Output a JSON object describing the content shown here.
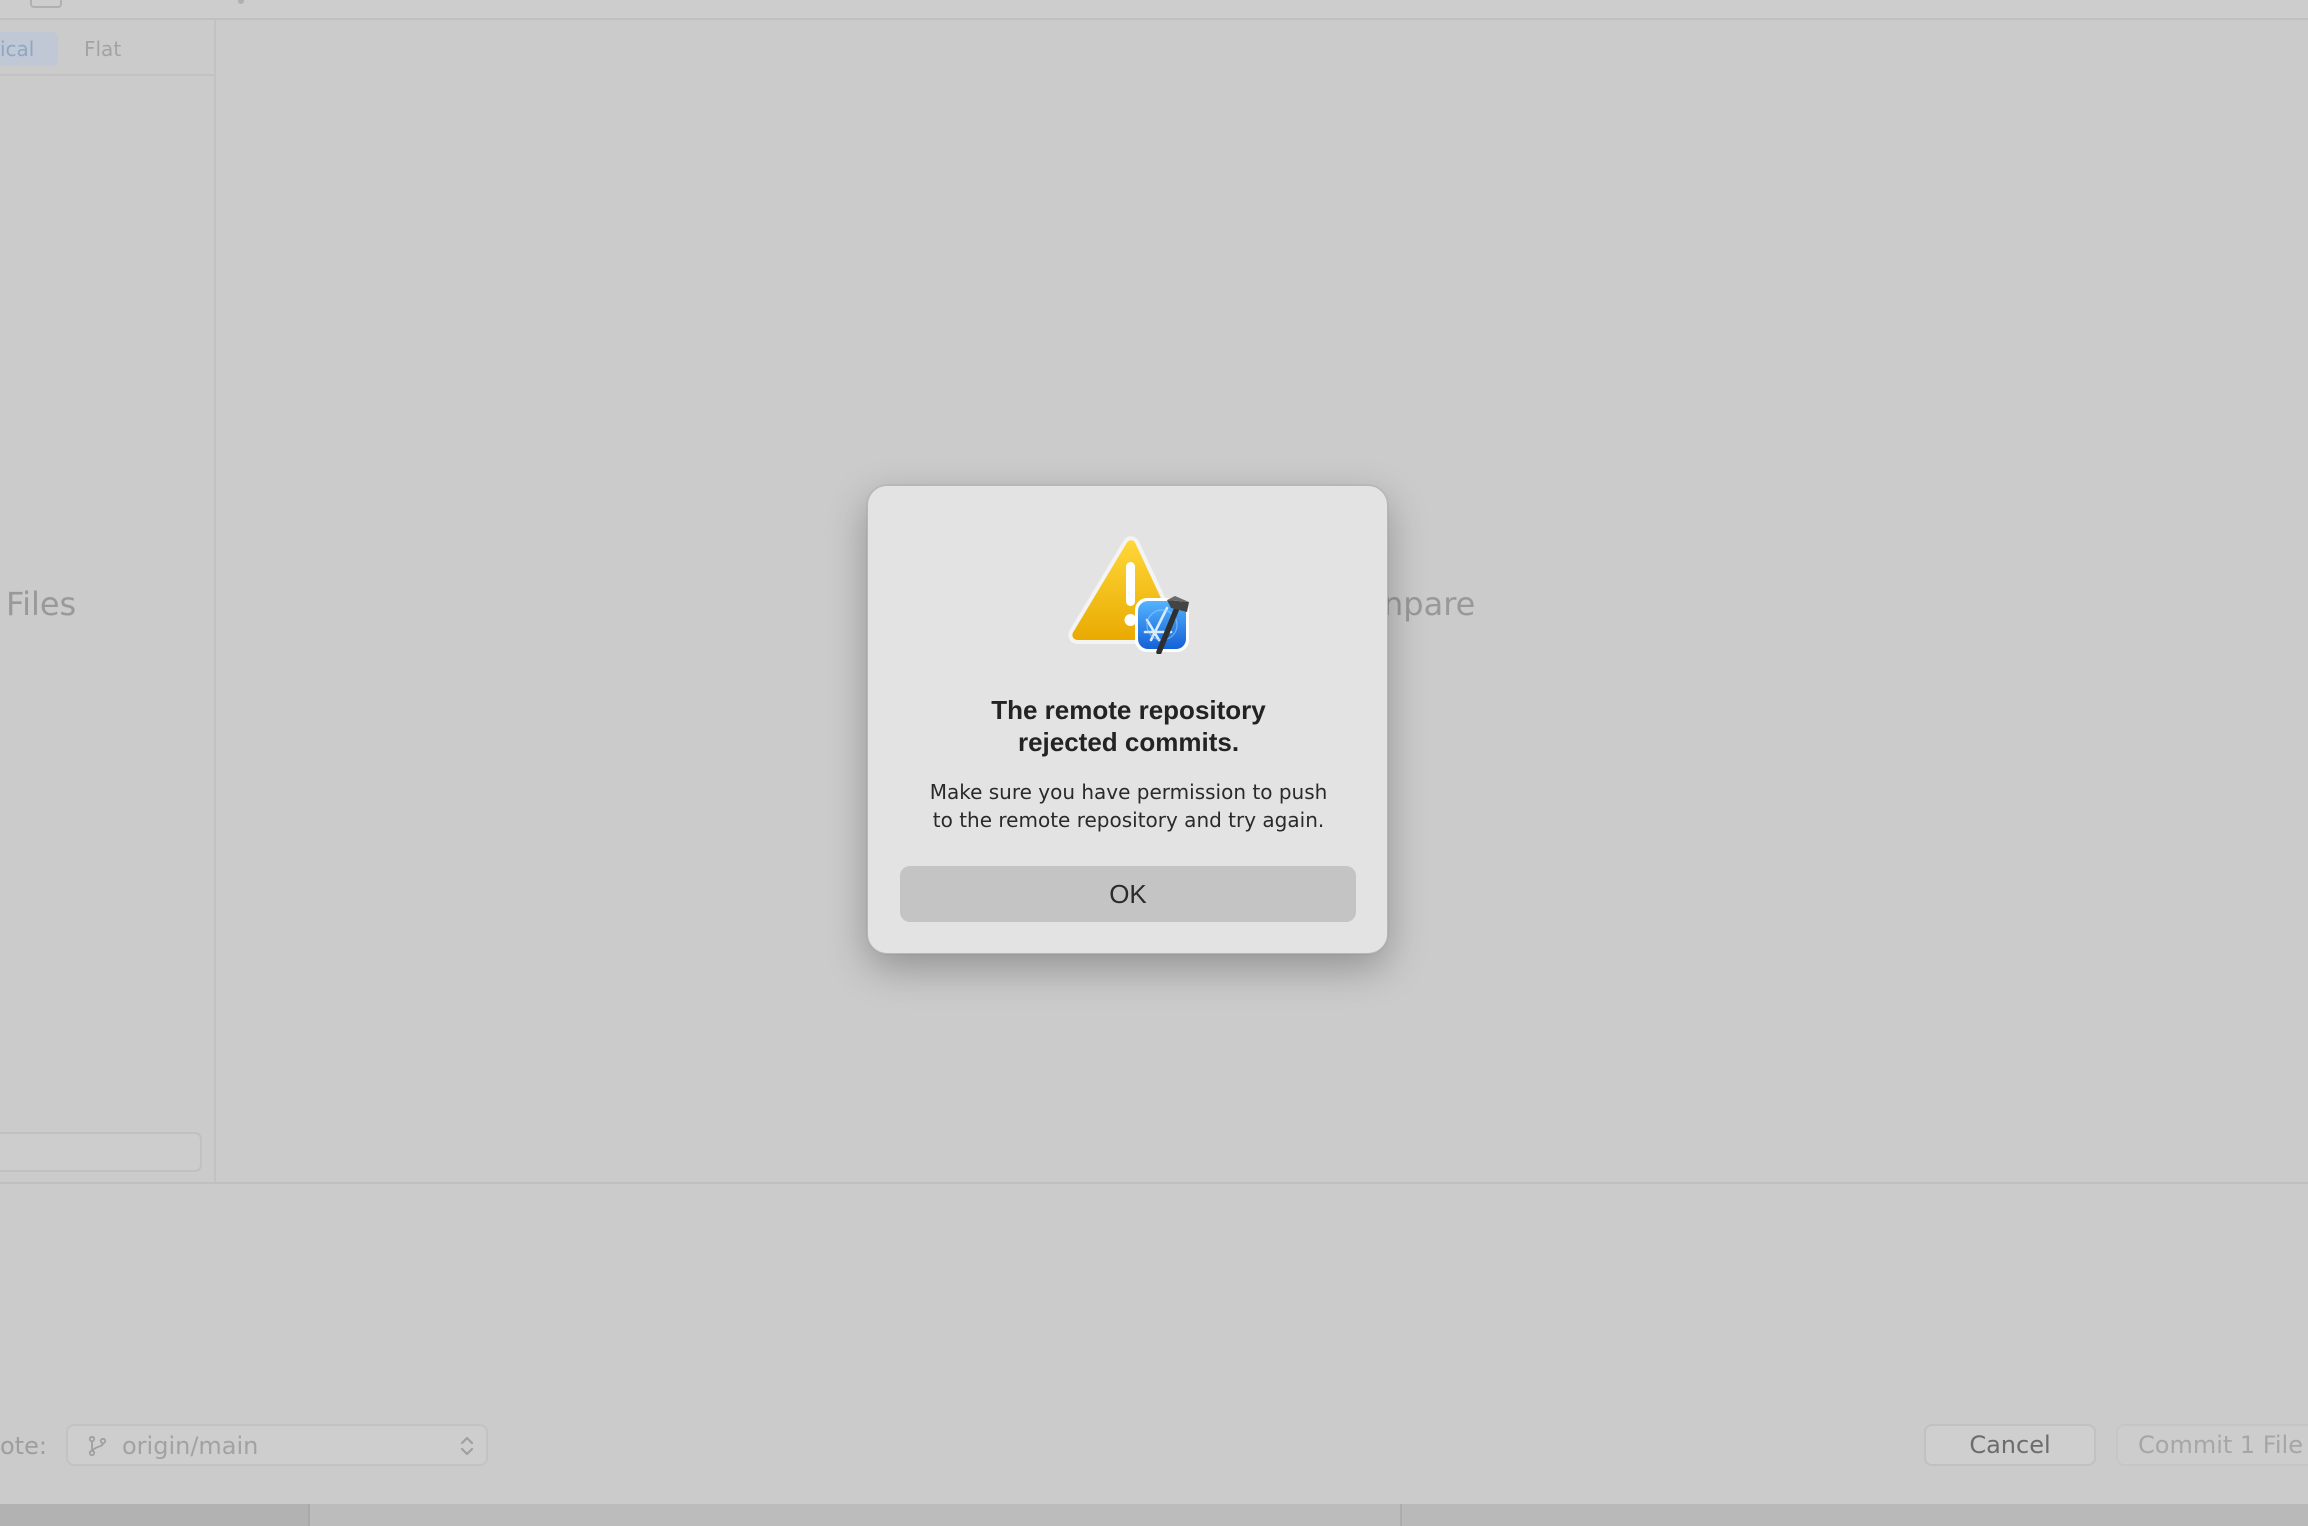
{
  "sidebar": {
    "segments": [
      {
        "label": "ical",
        "active": true
      },
      {
        "label": "Flat",
        "active": false
      }
    ],
    "empty_state_text": "Files"
  },
  "main": {
    "empty_state_text": "npare"
  },
  "footer": {
    "remote_label": "ote:",
    "branch_value": "origin/main",
    "cancel_label": "Cancel",
    "commit_label": "Commit 1 File"
  },
  "alert": {
    "title_line1": "The remote repository",
    "title_line2": "rejected commits.",
    "message_line1": "Make sure you have permission to push",
    "message_line2": "to the remote repository and try again.",
    "ok_label": "OK",
    "icon": "warning-xcode-icon"
  },
  "colors": {
    "dim_background": "#cbcbcb",
    "alert_background": "#e3e3e3",
    "ok_button": "#c4c4c4",
    "warning_yellow": "#f2c200",
    "xcode_blue": "#1f7ae0"
  }
}
